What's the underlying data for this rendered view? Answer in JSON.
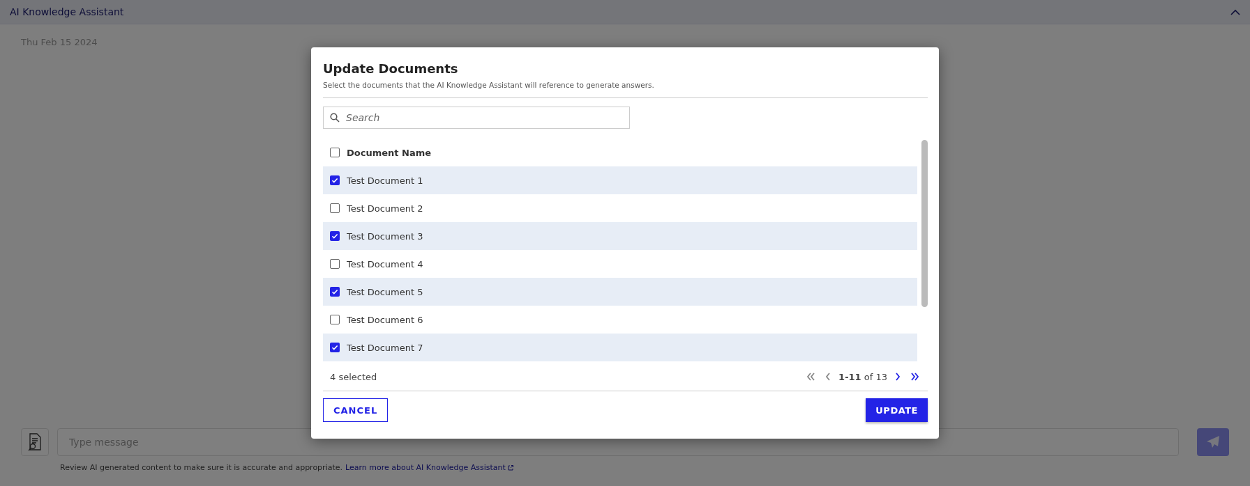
{
  "header": {
    "title": "AI Knowledge Assistant",
    "expanded": true
  },
  "chat": {
    "date": "Thu Feb 15 2024",
    "message_placeholder": "Type message",
    "disclaimer": "Review AI generated content to make sure it is accurate and appropriate.",
    "learn_more_link": "Learn more about AI Knowledge Assistant"
  },
  "dialog": {
    "title": "Update Documents",
    "subtitle": "Select the documents that the AI Knowledge Assistant will reference to generate answers.",
    "search_placeholder": "Search",
    "table": {
      "column": "Document Name",
      "all_checked": false,
      "rows": [
        {
          "name": "Test Document 1",
          "checked": true
        },
        {
          "name": "Test Document 2",
          "checked": false
        },
        {
          "name": "Test Document 3",
          "checked": true
        },
        {
          "name": "Test Document 4",
          "checked": false
        },
        {
          "name": "Test Document 5",
          "checked": true
        },
        {
          "name": "Test Document 6",
          "checked": false
        },
        {
          "name": "Test Document 7",
          "checked": true
        }
      ]
    },
    "selected_count": "4 selected",
    "page_range": "1-11",
    "page_total": "of 13",
    "buttons": {
      "cancel": "CANCEL",
      "update": "UPDATE"
    }
  }
}
